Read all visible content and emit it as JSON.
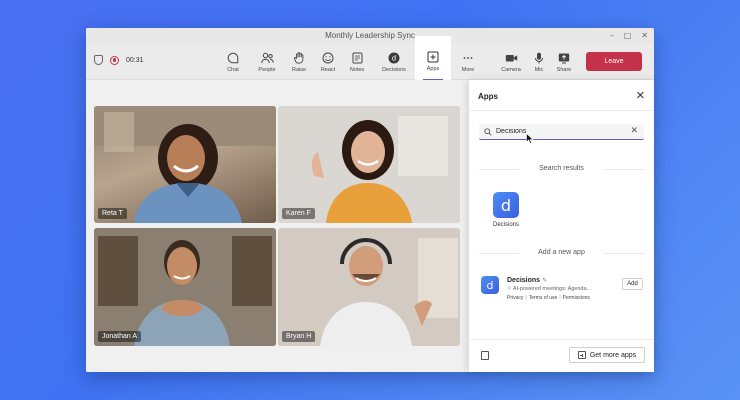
{
  "window": {
    "title": "Monthly Leadership Sync",
    "controls": [
      "–",
      "□",
      "✕"
    ]
  },
  "toolbar": {
    "timer": "00:31",
    "buttons": [
      {
        "label": "Chat",
        "icon": "chat-icon"
      },
      {
        "label": "People",
        "icon": "people-icon"
      },
      {
        "label": "Raise",
        "icon": "raise-hand-icon"
      },
      {
        "label": "React",
        "icon": "react-icon"
      },
      {
        "label": "Notes",
        "icon": "notes-icon"
      },
      {
        "label": "Decisions",
        "icon": "decisions-icon"
      },
      {
        "label": "Apps",
        "icon": "apps-icon",
        "active": true
      },
      {
        "label": "More",
        "icon": "more-icon"
      },
      {
        "label": "Camera",
        "icon": "camera-icon"
      },
      {
        "label": "Mic",
        "icon": "mic-icon"
      },
      {
        "label": "Share",
        "icon": "share-icon"
      }
    ],
    "leave_label": "Leave"
  },
  "participants": [
    {
      "name": "Reta T"
    },
    {
      "name": "Karen F"
    },
    {
      "name": "Jonathan A"
    },
    {
      "name": "Bryan H"
    }
  ],
  "apps_panel": {
    "title": "Apps",
    "search_value": "Decisions",
    "search_results_label": "Search results",
    "result": {
      "name": "Decisions",
      "icon_letter": "d"
    },
    "add_section_label": "Add a new app",
    "new_app": {
      "name": "Decisions",
      "verified_glyph": "✎",
      "description": "AI-powered meetings: Agenda...",
      "links": [
        "Privacy",
        "Terms of use",
        "Permissions"
      ],
      "add_label": "Add",
      "icon_letter": "d"
    },
    "get_more_label": "Get more apps"
  },
  "colors": {
    "accent": "#5b5fc7",
    "leave": "#c4314b",
    "app_brand": "#3f6fe8"
  }
}
